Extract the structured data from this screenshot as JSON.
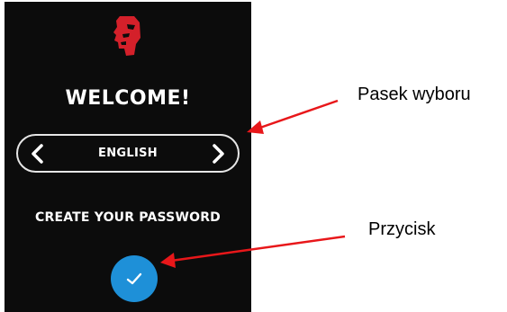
{
  "device": {
    "welcome_title": "WELCOME!",
    "language_selector": {
      "selected_value": "ENGLISH",
      "prev_icon": "chevron-left-icon",
      "next_icon": "chevron-right-icon"
    },
    "prompt": "CREATE YOUR PASSWORD",
    "confirm_button": {
      "icon": "checkmark-icon"
    },
    "logo": "kingston-head-logo"
  },
  "annotations": {
    "selector_label": "Pasek wyboru",
    "button_label": "Przycisk",
    "arrow_color": "#e8171a"
  },
  "colors": {
    "screen_background": "#0c0c0c",
    "logo_red": "#d4202a",
    "button_blue": "#1e90d8",
    "text": "#ffffff"
  }
}
